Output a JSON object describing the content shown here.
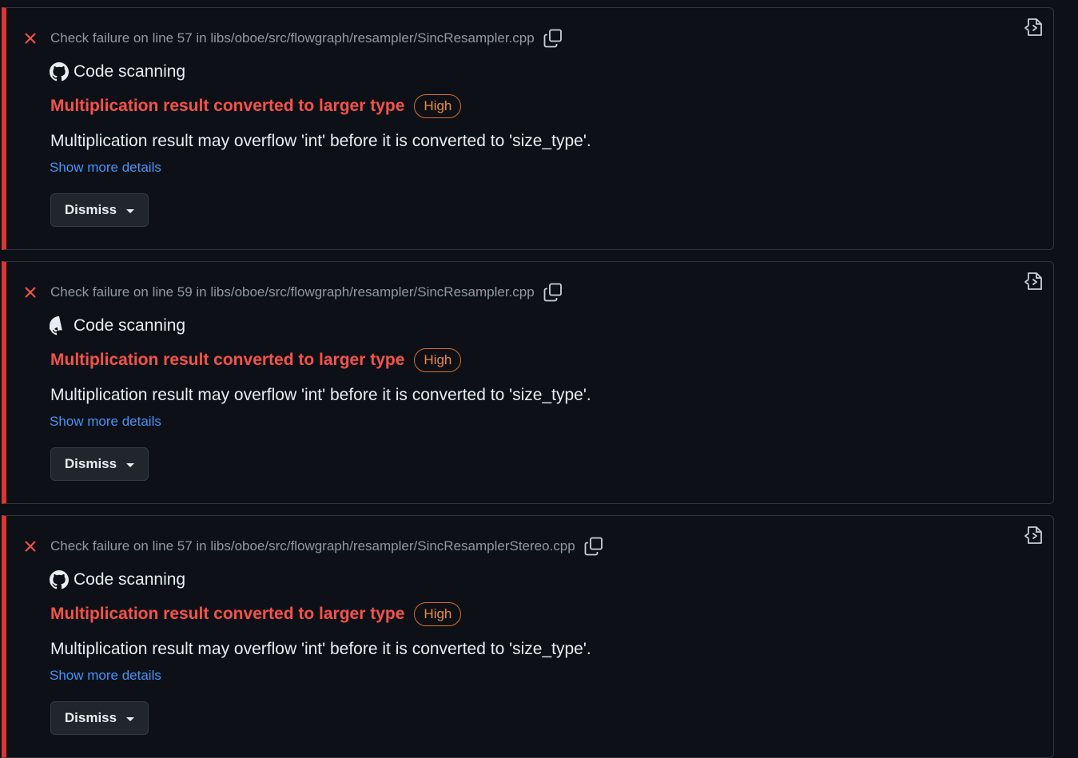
{
  "colors": {
    "background": "#0d1117",
    "failure_border": "#da3633",
    "title_red": "#f85149",
    "severity_orange": "#f0883e",
    "link_blue": "#4493f8"
  },
  "annotations": [
    {
      "status_icon": "x-icon",
      "path_text": "Check failure on line 57 in libs/oboe/src/flowgraph/resampler/SincResampler.cpp",
      "source_icon": "github-icon",
      "source_label": "Code scanning",
      "title": "Multiplication result converted to larger type",
      "severity": "High",
      "description": "Multiplication result may overflow 'int' before it is converted to 'size_type'.",
      "more_link": "Show more details",
      "dismiss_label": "Dismiss"
    },
    {
      "status_icon": "x-icon",
      "path_text": "Check failure on line 59 in libs/oboe/src/flowgraph/resampler/SincResampler.cpp",
      "source_icon": "github-icon",
      "source_label": "Code scanning",
      "title": "Multiplication result converted to larger type",
      "severity": "High",
      "description": "Multiplication result may overflow 'int' before it is converted to 'size_type'.",
      "more_link": "Show more details",
      "dismiss_label": "Dismiss"
    },
    {
      "status_icon": "x-icon",
      "path_text": "Check failure on line 57 in libs/oboe/src/flowgraph/resampler/SincResamplerStereo.cpp",
      "source_icon": "github-icon",
      "source_label": "Code scanning",
      "title": "Multiplication result converted to larger type",
      "severity": "High",
      "description": "Multiplication result may overflow 'int' before it is converted to 'size_type'.",
      "more_link": "Show more details",
      "dismiss_label": "Dismiss"
    }
  ]
}
